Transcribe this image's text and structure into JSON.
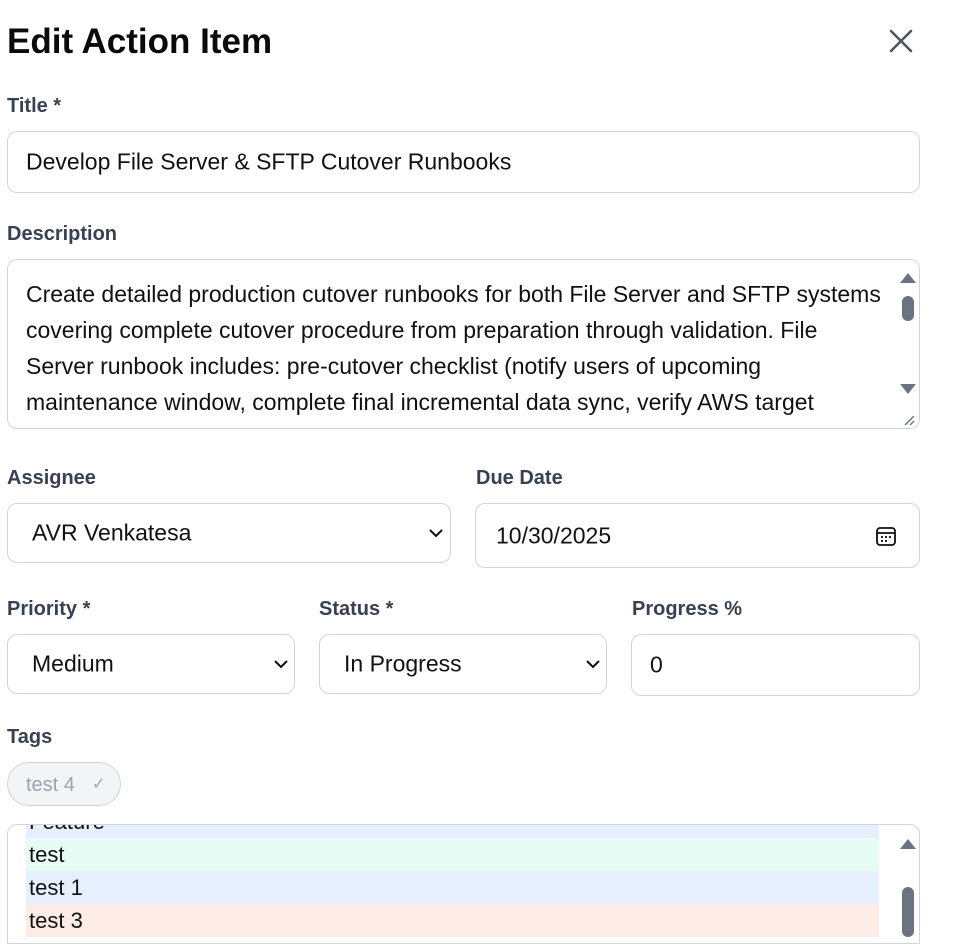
{
  "dialog": {
    "title": "Edit Action Item",
    "close_icon": "close-icon"
  },
  "title_field": {
    "label": "Title *",
    "value": "Develop File Server & SFTP Cutover Runbooks"
  },
  "description_field": {
    "label": "Description",
    "value": "Create detailed production cutover runbooks for both File Server and SFTP systems covering complete cutover procedure from preparation through validation. File Server runbook includes: pre-cutover checklist (notify users of upcoming maintenance window, complete final incremental data sync, verify AWS target readiness, confirm backup completion), cutover steps and rollback"
  },
  "assignee_field": {
    "label": "Assignee",
    "value": "AVR Venkatesa"
  },
  "due_date_field": {
    "label": "Due Date",
    "value": "10/30/2025",
    "icon": "calendar-icon"
  },
  "priority_field": {
    "label": "Priority *",
    "value": "Medium"
  },
  "status_field": {
    "label": "Status *",
    "value": "In Progress"
  },
  "progress_field": {
    "label": "Progress %",
    "value": "0"
  },
  "tags": {
    "label": "Tags",
    "selected": [
      {
        "label": "test 4",
        "icon": "check-icon"
      }
    ],
    "options": [
      {
        "label": "Feature",
        "color": "#e6effd"
      },
      {
        "label": "test",
        "color": "#e6fcf5"
      },
      {
        "label": "test 1",
        "color": "#e6effd"
      },
      {
        "label": "test 3",
        "color": "#fdece6"
      }
    ]
  }
}
